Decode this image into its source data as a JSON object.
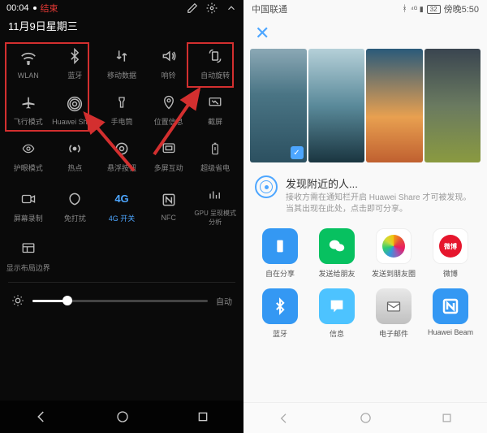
{
  "left": {
    "status": {
      "time": "00:04",
      "rec": "结束"
    },
    "date": "11月9日星期三",
    "tiles": [
      [
        {
          "label": "WLAN",
          "icon": "wifi"
        },
        {
          "label": "蓝牙",
          "icon": "bluetooth"
        },
        {
          "label": "移动数据",
          "icon": "data"
        },
        {
          "label": "响铃",
          "icon": "sound"
        },
        {
          "label": "自动旋转",
          "icon": "rotate"
        }
      ],
      [
        {
          "label": "飞行模式",
          "icon": "airplane"
        },
        {
          "label": "Huawei Share",
          "icon": "share"
        },
        {
          "label": "手电筒",
          "icon": "torch"
        },
        {
          "label": "位置信息",
          "icon": "location"
        },
        {
          "label": "截屏",
          "icon": "screenshot"
        }
      ],
      [
        {
          "label": "护眼模式",
          "icon": "eye"
        },
        {
          "label": "热点",
          "icon": "hotspot"
        },
        {
          "label": "悬浮按钮",
          "icon": "float"
        },
        {
          "label": "多屏互动",
          "icon": "cast"
        },
        {
          "label": "超级省电",
          "icon": "battery"
        }
      ],
      [
        {
          "label": "屏幕录制",
          "icon": "record"
        },
        {
          "label": "免打扰",
          "icon": "dnd"
        },
        {
          "label": "4G 开关",
          "icon": "4g",
          "active": true
        },
        {
          "label": "NFC",
          "icon": "nfc"
        },
        {
          "label": "GPU 呈现模式分析",
          "icon": "gpu"
        }
      ]
    ],
    "moreLabel": "显示布局边界",
    "brightness": {
      "auto": "自动"
    }
  },
  "right": {
    "status": {
      "carrier": "中国联通",
      "time": "傍晚5:50"
    },
    "discover": {
      "title": "发现附近的人...",
      "sub": "接收方需在通知栏开启 Huawei Share 才可被发现。当其出现在此处，点击即可分享。"
    },
    "share": [
      [
        {
          "label": "自在分享",
          "cls": "bg-blue"
        },
        {
          "label": "发送给朋友",
          "cls": "bg-green"
        },
        {
          "label": "发送到朋友圈",
          "cls": "bg-multi"
        },
        {
          "label": "微博",
          "cls": "bg-orange"
        }
      ],
      [
        {
          "label": "蓝牙",
          "cls": "bg-blue"
        },
        {
          "label": "信息",
          "cls": "bg-msg"
        },
        {
          "label": "电子邮件",
          "cls": "bg-mail"
        },
        {
          "label": "Huawei Beam",
          "cls": "bg-blue"
        }
      ]
    ]
  }
}
